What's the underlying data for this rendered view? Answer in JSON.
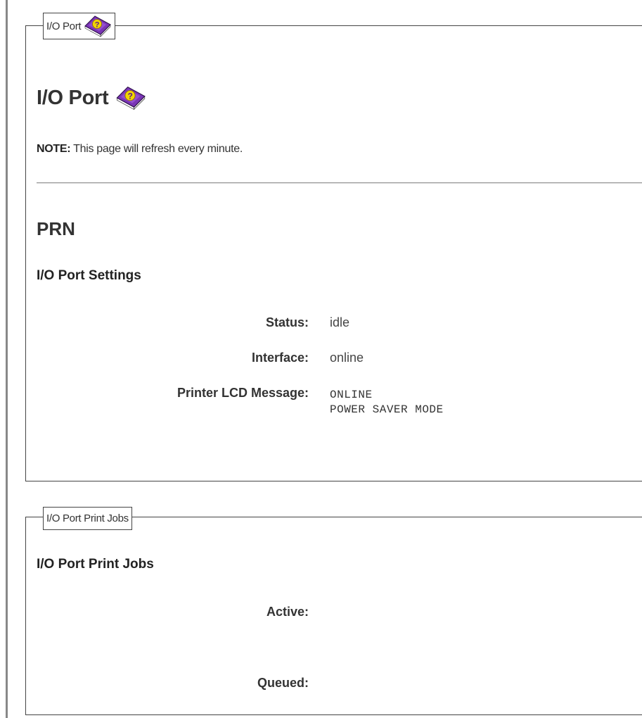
{
  "io_port_panel": {
    "legend_label": "I/O Port",
    "heading": "I/O Port",
    "note_label": "NOTE:",
    "note_text": " This page will refresh every minute.",
    "port_name": "PRN",
    "settings_heading": "I/O Port Settings",
    "fields": {
      "status_label": "Status:",
      "status_value": "idle",
      "interface_label": "Interface:",
      "interface_value": "online",
      "lcd_label": "Printer LCD Message:",
      "lcd_line1": "ONLINE",
      "lcd_line2": "POWER SAVER MODE"
    }
  },
  "print_jobs_panel": {
    "legend_label": "I/O Port Print Jobs",
    "heading": "I/O Port Print Jobs",
    "active_label": "Active:",
    "queued_label": "Queued:"
  },
  "icons": {
    "help": "help-book-icon"
  },
  "colors": {
    "book_purple": "#6b2fa0",
    "book_yellow": "#f2d400",
    "text_dark": "#333333",
    "border": "#444444"
  }
}
